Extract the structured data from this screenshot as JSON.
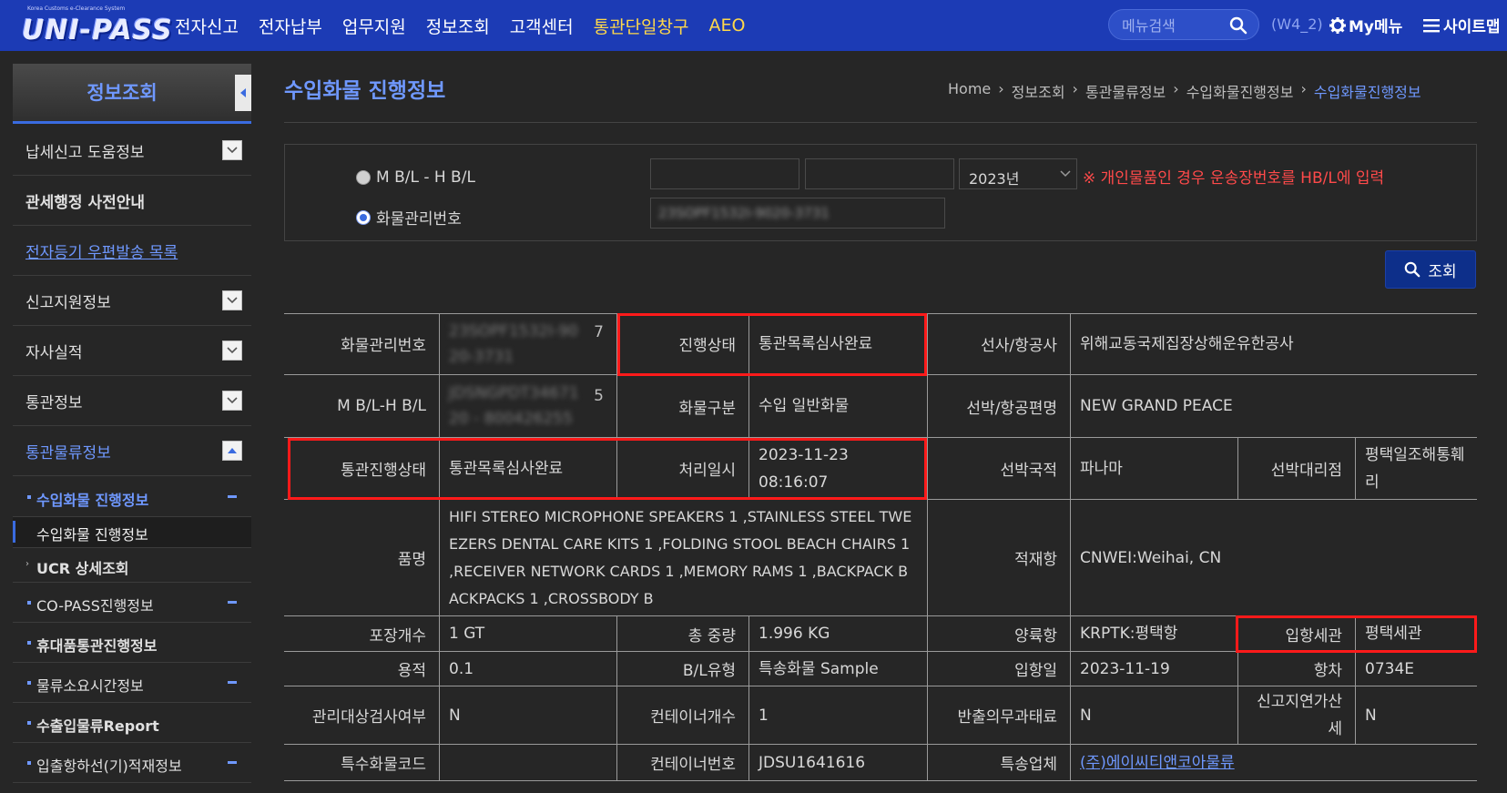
{
  "header": {
    "logo_tagline": "Korea Customs e-Clearance System",
    "logo_text": "UNI-PASS",
    "nav": [
      "전자신고",
      "전자납부",
      "업무지원",
      "정보조회",
      "고객센터",
      "통관단일창구",
      "AEO"
    ],
    "search_placeholder": "메뉴검색",
    "user_id": "(W4_2)",
    "my_menu": "My메뉴",
    "sitemap": "사이트맵"
  },
  "sidebar": {
    "title": "정보조회",
    "items": [
      {
        "label": "납세신고 도움정보",
        "style": "normal"
      },
      {
        "label": "관세행정 사전안내",
        "style": "bold"
      },
      {
        "label": "전자등기 우편발송 목록",
        "style": "link"
      },
      {
        "label": "신고지원정보",
        "style": "normal"
      },
      {
        "label": "자사실적",
        "style": "normal"
      },
      {
        "label": "통관정보",
        "style": "normal"
      },
      {
        "label": "통관물류정보",
        "style": "blue"
      }
    ],
    "sub_items": [
      {
        "label": "수입화물 진행정보"
      },
      {
        "label": "수입화물 진행정보"
      },
      {
        "label": "UCR 상세조회"
      },
      {
        "label": "CO-PASS진행정보"
      },
      {
        "label": "휴대품통관진행정보"
      },
      {
        "label": "물류소요시간정보"
      },
      {
        "label": "수출입물류Report"
      },
      {
        "label": "입출항하선(기)적재정보"
      }
    ]
  },
  "page": {
    "title": "수입화물 진행정보",
    "breadcrumb": [
      "Home",
      "정보조회",
      "통관물류정보",
      "수입화물진행정보",
      "수입화물진행정보"
    ]
  },
  "search": {
    "radio_mbl": "M B/L - H B/L",
    "radio_cargo": "화물관리번호",
    "year": "2023년",
    "notice": "※ 개인물품인 경우 운송장번호를 HB/L에 입력",
    "cargo_number": "23SOPF1532I-9020-3731",
    "button": "조회"
  },
  "table": {
    "cargo_no_label": "화물관리번호",
    "cargo_no_value": "23SOPF1532I-9020-3731",
    "cargo_no_suffix": "7",
    "status_label": "진행상태",
    "status_value": "통관목록심사완료",
    "carrier_label": "선사/항공사",
    "carrier_value": "위해교동국제집장상해운유한공사",
    "bl_label": "M B/L-H B/L",
    "bl_value": "JDSNGPDT3467120 - 800426255",
    "bl_suffix": "5",
    "cargo_type_label": "화물구분",
    "cargo_type_value": "수입 일반화물",
    "vessel_label": "선박/항공편명",
    "vessel_value": "NEW GRAND PEACE",
    "customs_status_label": "통관진행상태",
    "customs_status_value": "통관목록심사완료",
    "processed_label": "처리일시",
    "processed_value": "2023-11-23 08:16:07",
    "nationality_label": "선박국적",
    "nationality_value": "파나마",
    "agent_label": "선박대리점",
    "agent_value": "평택일조해통훼리",
    "item_label": "품명",
    "item_value": "HIFI STEREO MICROPHONE SPEAKERS 1 ,STAINLESS STEEL TWEEZERS DENTAL CARE KITS 1 ,FOLDING STOOL BEACH CHAIRS 1 ,RECEIVER NETWORK CARDS 1 ,MEMORY RAMS 1 ,BACKPACK BACKPACKS 1 ,CROSSBODY B",
    "loading_port_label": "적재항",
    "loading_port_value": "CNWEI:Weihai, CN",
    "packages_label": "포장개수",
    "packages_value": "1 GT",
    "weight_label": "총 중량",
    "weight_value": "1.996 KG",
    "unloading_port_label": "양륙항",
    "unloading_port_value": "KRPTK:평택항",
    "entry_customs_label": "입항세관",
    "entry_customs_value": "평택세관",
    "volume_label": "용적",
    "volume_value": "0.1",
    "bl_type_label": "B/L유형",
    "bl_type_value": "특송화물 Sample",
    "entry_date_label": "입항일",
    "entry_date_value": "2023-11-19",
    "voyage_label": "항차",
    "voyage_value": "0734E",
    "inspection_label": "관리대상검사여부",
    "inspection_value": "N",
    "container_count_label": "컨테이너개수",
    "container_count_value": "1",
    "carry_out_label": "반출의무과태료",
    "carry_out_value": "N",
    "late_tax_label": "신고지연가산세",
    "late_tax_value": "N",
    "special_code_label": "특수화물코드",
    "special_code_value": "",
    "container_no_label": "컨테이너번호",
    "container_no_value": "JDSU1641616",
    "courier_label": "특송업체",
    "courier_value": "(주)에이씨티앤코아물류"
  }
}
